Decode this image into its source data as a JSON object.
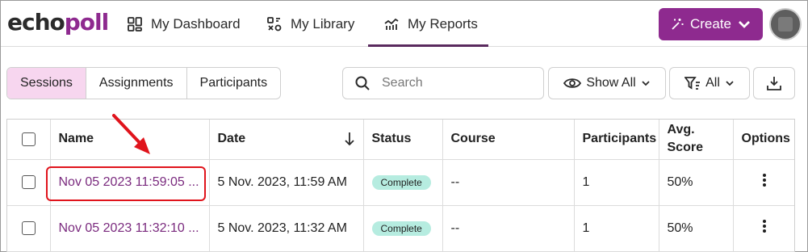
{
  "brand": {
    "logo_part1": "echo",
    "logo_part2": "poll"
  },
  "nav": {
    "dashboard": "My Dashboard",
    "library": "My Library",
    "reports": "My Reports"
  },
  "create_button": {
    "label": "Create"
  },
  "toolbar": {
    "tabs": [
      "Sessions",
      "Assignments",
      "Participants"
    ],
    "search_placeholder": "Search",
    "show_all_label": "Show All",
    "filter_label": "All"
  },
  "table": {
    "headers": {
      "name": "Name",
      "date": "Date",
      "status": "Status",
      "course": "Course",
      "participants": "Participants",
      "avg_score": "Avg. Score",
      "options": "Options"
    },
    "rows": [
      {
        "name": "Nov 05 2023 11:59:05 ...",
        "date": "5 Nov. 2023, 11:59 AM",
        "status": "Complete",
        "course": "--",
        "participants": "1",
        "avg_score": "50%"
      },
      {
        "name": "Nov 05 2023 11:32:10 ...",
        "date": "5 Nov. 2023, 11:32 AM",
        "status": "Complete",
        "course": "--",
        "participants": "1",
        "avg_score": "50%"
      }
    ]
  },
  "colors": {
    "brand_purple": "#8e2a8f",
    "active_tab": "#f7d6ef",
    "link": "#7a2a7e",
    "badge": "#b6ece0",
    "annotation_red": "#e0141c"
  },
  "icons": {
    "dashboard": "grid-icon",
    "library": "library-icon",
    "reports": "chart-icon",
    "create": "magic-wand-icon",
    "search": "search-icon",
    "show_all": "eye-icon",
    "filter": "filter-icon",
    "download": "download-icon",
    "sort": "arrow-down-icon",
    "options": "kebab-icon"
  }
}
